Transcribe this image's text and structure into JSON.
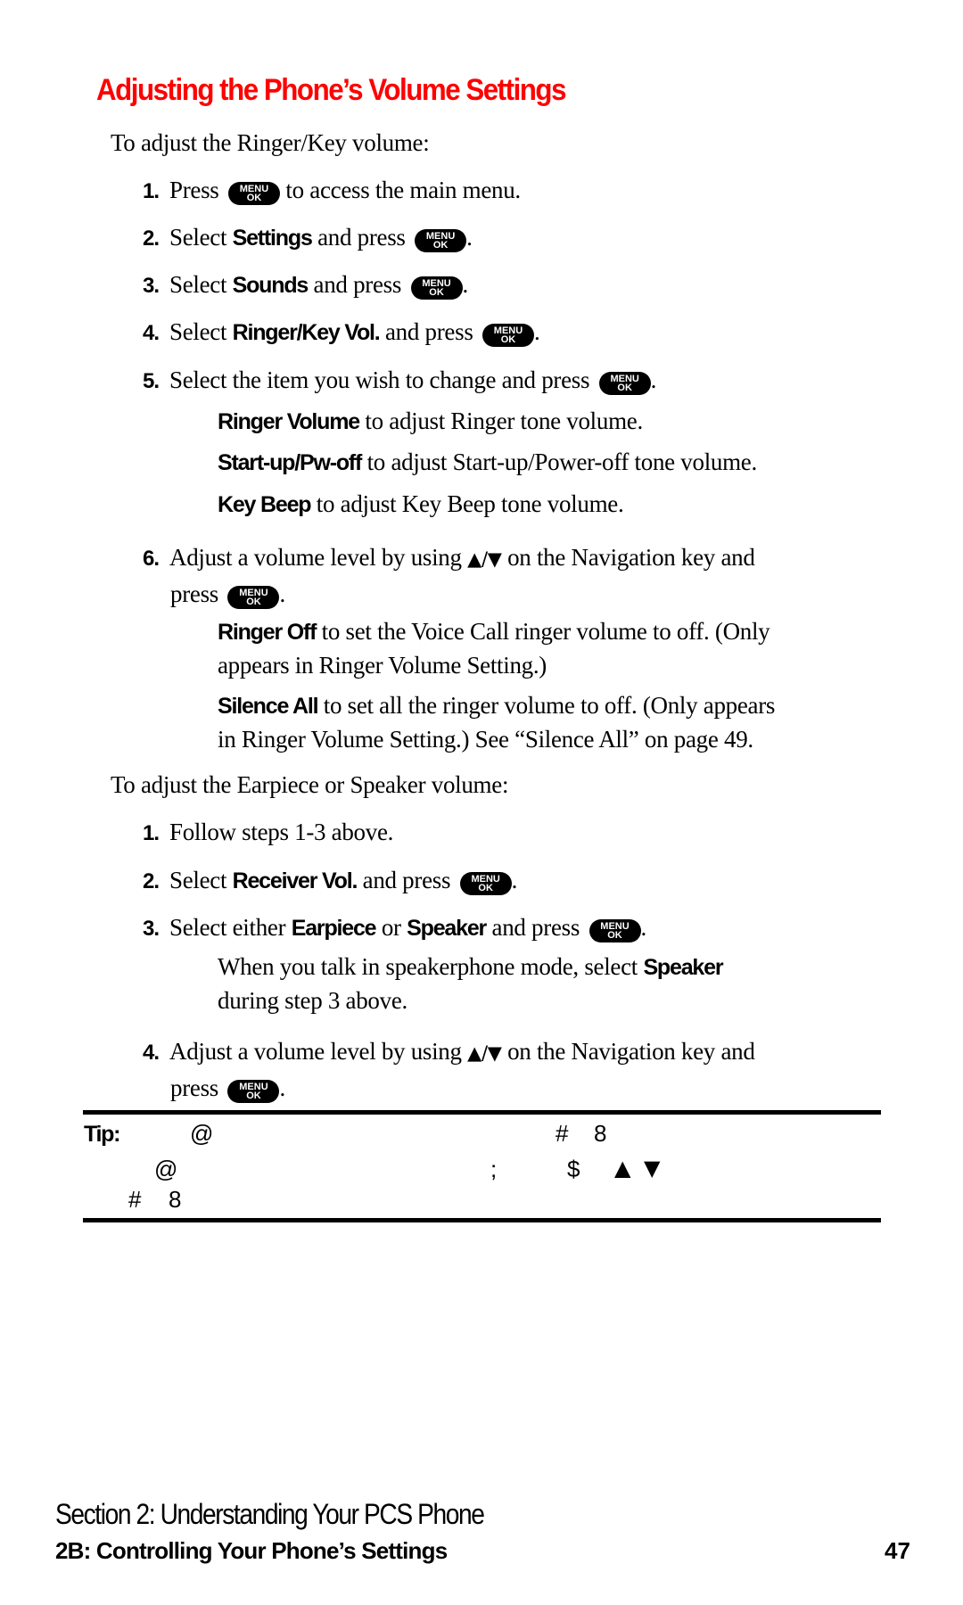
{
  "title": "Adjusting the Phone’s Volume Settings",
  "key_label": {
    "top": "MENU",
    "bottom": "OK"
  },
  "arrows": "▲/▼",
  "ringer_section": {
    "intro": "To adjust the Ringer/Key volume:",
    "steps": [
      {
        "num": "1.",
        "pre": "Press",
        "post": " to access the main menu."
      },
      {
        "num": "2.",
        "pre": "Select ",
        "bold": "Settings",
        "post": " and press"
      },
      {
        "num": "3.",
        "pre": "Select ",
        "bold": "Sounds",
        "post": " and press"
      },
      {
        "num": "4.",
        "pre": "Select ",
        "bold": "Ringer/Key Vol.",
        "post": " and press"
      },
      {
        "num": "5.",
        "pre": "Select the item you wish to change and press"
      },
      {
        "num": "6.",
        "pre": "Adjust a volume level by using ",
        "post": " on the Navigation key and",
        "cont": "press"
      }
    ],
    "options": [
      {
        "bold": "Ringer Volume",
        "text": " to adjust Ringer tone volume."
      },
      {
        "bold": "Start-up/Pw-off",
        "text": " to adjust Start-up/Power-off tone volume."
      },
      {
        "bold": "Key Beep",
        "text": " to adjust Key Beep tone volume."
      }
    ],
    "notes": [
      {
        "bold": "Ringer Off",
        "line1": " to set the Voice Call ringer volume to off. (Only",
        "line2": "appears in Ringer Volume Setting.)"
      },
      {
        "bold": "Silence All",
        "line1": " to set all the ringer volume to off. (Only appears",
        "line2": "in Ringer Volume Setting.) See “Silence All” on page 49."
      }
    ]
  },
  "earpiece_section": {
    "intro": "To adjust the Earpiece or Speaker volume:",
    "steps": [
      {
        "num": "1.",
        "pre": "Follow steps 1-3 above."
      },
      {
        "num": "2.",
        "pre": "Select ",
        "bold": "Receiver Vol.",
        "post": " and press"
      },
      {
        "num": "3.",
        "pre": "Select either ",
        "bold": "Earpiece",
        "mid": " or ",
        "bold2": "Speaker",
        "post": " and press"
      },
      {
        "num": "4.",
        "pre": "Adjust a volume level by using ",
        "post": " on the Navigation key and",
        "cont": "press"
      }
    ],
    "note": {
      "line1": "When you talk in speakerphone mode, select ",
      "bold": "Speaker",
      "line2": "during step 3 above."
    }
  },
  "tip": {
    "label": "Tip:",
    "glyphs": [
      "@",
      "#",
      "8",
      "@",
      ";",
      "$",
      "▲",
      "▼",
      "#",
      "8"
    ]
  },
  "footer": {
    "section": "Section 2: Understanding Your PCS Phone",
    "chapter": "2B: Controlling Your Phone’s Settings",
    "page": "47"
  }
}
